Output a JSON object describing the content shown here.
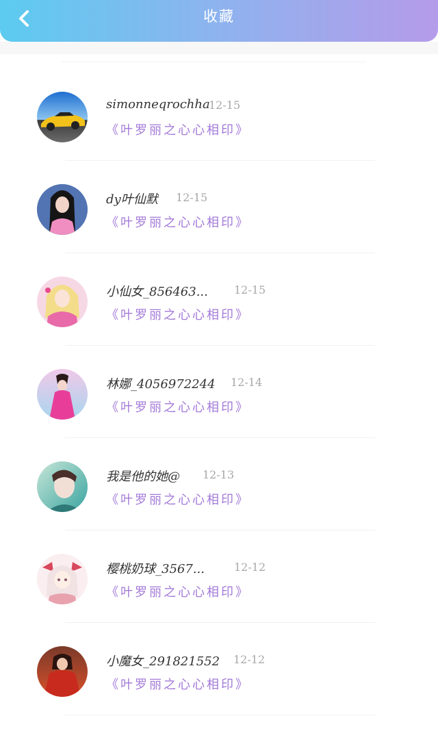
{
  "header": {
    "title": "收藏",
    "back_icon": "chevron-left-icon",
    "gradient_colors": [
      "#5ccbef",
      "#b59bea"
    ]
  },
  "accent_color": "#a37ad8",
  "favorites": [
    {
      "user": "simonneqrochha",
      "date": "12-15",
      "work": "《叶罗丽之心心相印》",
      "avatar": "yellow-sports-car-avatar"
    },
    {
      "user": "dy叶仙默",
      "date": "12-15",
      "work": "《叶罗丽之心心相印》",
      "avatar": "doll-pink-dress-avatar"
    },
    {
      "user": "小仙女_856463...",
      "date": "12-15",
      "work": "《叶罗丽之心心相印》",
      "avatar": "blonde-fairy-avatar"
    },
    {
      "user": "林娜_4056972244",
      "date": "12-14",
      "work": "《叶罗丽之心心相印》",
      "avatar": "pink-doll-avatar"
    },
    {
      "user": "我是他的她@",
      "date": "12-13",
      "work": "《叶罗丽之心心相印》",
      "avatar": "teal-portrait-avatar"
    },
    {
      "user": "樱桃奶球_3567...",
      "date": "12-12",
      "work": "《叶罗丽之心心相印》",
      "avatar": "anime-girl-bow-avatar"
    },
    {
      "user": "小魔女_291821552",
      "date": "12-12",
      "work": "《叶罗丽之心心相印》",
      "avatar": "red-fantasy-avatar"
    }
  ]
}
